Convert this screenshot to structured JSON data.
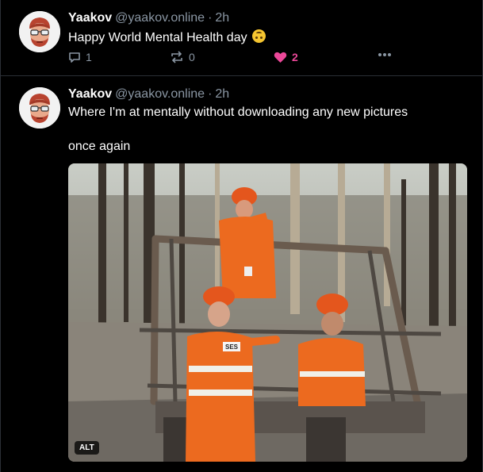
{
  "posts": [
    {
      "author": "Yaakov",
      "handle": "@yaakov.online",
      "time": "2h",
      "text": "Happy World Mental Health day",
      "emoji_icon": "upside-down-face-emoji",
      "replies": "1",
      "reposts": "0",
      "likes": "2"
    },
    {
      "author": "Yaakov",
      "handle": "@yaakov.online",
      "time": "2h",
      "text_line1": "Where I'm at mentally without downloading any new pictures",
      "text_line2": "once again",
      "image_alt_badge": "ALT",
      "image_badge_text": "SES"
    }
  ],
  "colors": {
    "background": "#000000",
    "muted": "#8a96a3",
    "like": "#ec4899",
    "divider": "#2b2f36"
  }
}
